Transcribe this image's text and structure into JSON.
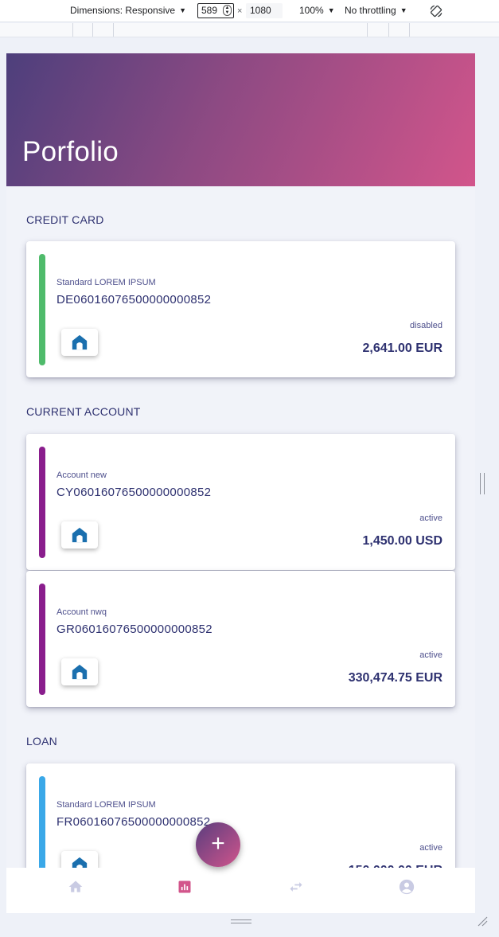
{
  "devtools": {
    "dimensions_label": "Dimensions: Responsive",
    "width": "589",
    "height": "1080",
    "times": "×",
    "zoom": "100%",
    "throttling": "No throttling"
  },
  "app": {
    "title": "Porfolio"
  },
  "sections": [
    {
      "title": "CREDIT CARD",
      "accounts": [
        {
          "name": "Standard LOREM IPSUM",
          "iban": "DE06016076500000000852",
          "status": "disabled",
          "amount": "2,641.00 EUR",
          "accent": "#4fbb6b"
        }
      ]
    },
    {
      "title": "CURRENT ACCOUNT",
      "accounts": [
        {
          "name": "Account new",
          "iban": "CY06016076500000000852",
          "status": "active",
          "amount": "1,450.00 USD",
          "accent": "#8a1e8d"
        },
        {
          "name": "Account nwq",
          "iban": "GR06016076500000000852",
          "status": "active",
          "amount": "330,474.75 EUR",
          "accent": "#8a1e8d"
        }
      ]
    },
    {
      "title": "LOAN",
      "accounts": [
        {
          "name": "Standard LOREM IPSUM",
          "iban": "FR06016076500000000852",
          "status": "active",
          "amount": "150,000.00 EUR",
          "accent": "#3aa8e8"
        }
      ]
    }
  ],
  "fab": {
    "label": "+"
  },
  "nav": {
    "items": [
      "home-icon",
      "portfolio-chart-icon",
      "transfer-icon",
      "profile-icon"
    ],
    "active_color": "#d2558b",
    "inactive_color": "#c9cbe3"
  },
  "colors": {
    "text_primary": "#2e3170",
    "background": "#f1f3f9"
  }
}
